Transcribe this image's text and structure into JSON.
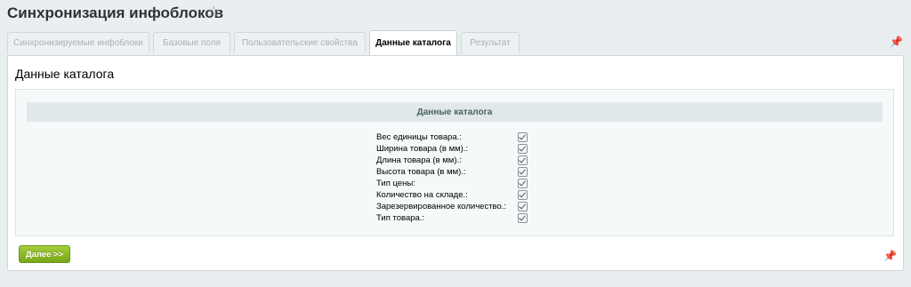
{
  "page": {
    "title": "Синхронизация инфоблоков",
    "star_icon": "star-icon"
  },
  "tabs": [
    {
      "label": "Синхронизируемые инфоблоки",
      "active": false
    },
    {
      "label": "Базовые поля",
      "active": false
    },
    {
      "label": "Пользовательские свойства",
      "active": false
    },
    {
      "label": "Данные каталога",
      "active": true
    },
    {
      "label": "Результат",
      "active": false
    }
  ],
  "main": {
    "heading": "Данные каталога",
    "section_title": "Данные каталога",
    "fields": [
      {
        "label": "Вес единицы товара.:",
        "checked": true
      },
      {
        "label": "Ширина товара (в мм).:",
        "checked": true
      },
      {
        "label": "Длина товара (в мм).:",
        "checked": true
      },
      {
        "label": "Высота товара (в мм).:",
        "checked": true
      },
      {
        "label": "Тип цены:",
        "checked": true
      },
      {
        "label": "Количество на складе.:",
        "checked": true
      },
      {
        "label": "Зарезервированное количество.:",
        "checked": true
      },
      {
        "label": "Тип товара.:",
        "checked": true
      }
    ]
  },
  "footer": {
    "next_label": "Далее >>"
  },
  "colors": {
    "accent_green": "#8bb82a",
    "background": "#e9eef0"
  }
}
